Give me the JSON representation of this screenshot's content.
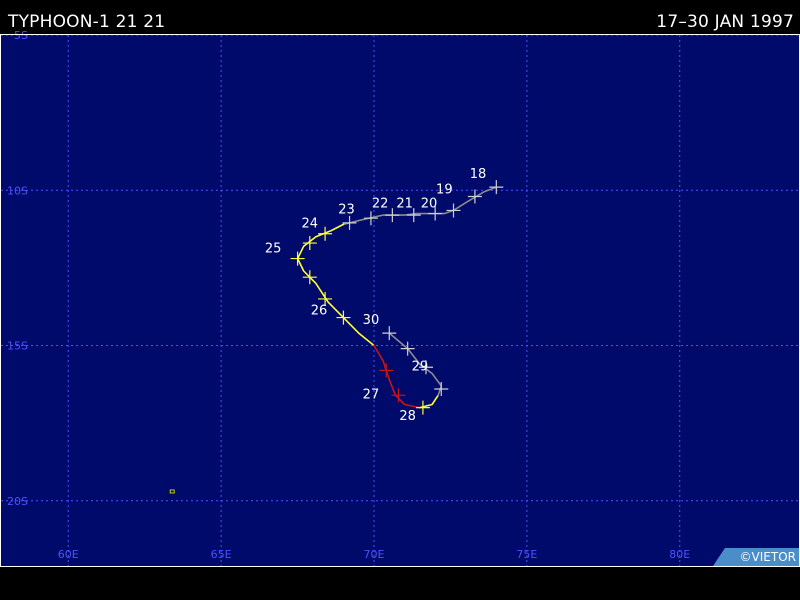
{
  "header": {
    "storm_title": "TYPHOON-1 21 21",
    "date_range": "17–30 JAN 1997"
  },
  "credit": "©VIETOR",
  "map": {
    "lon_range": [
      57.8,
      83.9
    ],
    "lat_range": [
      -5.0,
      -22.1
    ],
    "lon_ticks": [
      {
        "value": 60,
        "label": "60E"
      },
      {
        "value": 65,
        "label": "65E"
      },
      {
        "value": 70,
        "label": "70E"
      },
      {
        "value": 75,
        "label": "75E"
      },
      {
        "value": 80,
        "label": "80E"
      }
    ],
    "lat_ticks": [
      {
        "value": -5,
        "label": "5S"
      },
      {
        "value": -10,
        "label": "10S"
      },
      {
        "value": -15,
        "label": "15S"
      },
      {
        "value": -20,
        "label": "20S"
      }
    ],
    "colors": {
      "ocean": "#000a6b",
      "grid": "#4a52ff",
      "axis_label": "#4a52ff",
      "day_label": "#ffffff"
    },
    "intensity_colors": {
      "depression": "#8c8c8c",
      "storm": "#ffff33",
      "typhoon": "#c81414"
    },
    "islands": [
      {
        "lon": 63.4,
        "lat": -19.7,
        "color": "#c8c814"
      }
    ],
    "track_segments": [
      {
        "category": "depression",
        "points": [
          [
            74.0,
            -9.9
          ],
          [
            73.6,
            -10.05
          ],
          [
            73.0,
            -10.4
          ],
          [
            72.6,
            -10.65
          ],
          [
            72.3,
            -10.75
          ],
          [
            71.4,
            -10.75
          ],
          [
            71.0,
            -10.8
          ],
          [
            70.3,
            -10.8
          ],
          [
            69.6,
            -10.95
          ],
          [
            69.0,
            -11.1
          ]
        ]
      },
      {
        "category": "storm",
        "points": [
          [
            69.0,
            -11.1
          ],
          [
            68.6,
            -11.3
          ],
          [
            68.1,
            -11.5
          ],
          [
            67.7,
            -11.8
          ],
          [
            67.5,
            -12.2
          ],
          [
            67.7,
            -12.6
          ],
          [
            68.1,
            -13.0
          ],
          [
            68.5,
            -13.6
          ],
          [
            69.0,
            -14.1
          ],
          [
            69.5,
            -14.6
          ],
          [
            70.0,
            -15.0
          ]
        ]
      },
      {
        "category": "typhoon",
        "points": [
          [
            70.0,
            -15.0
          ],
          [
            70.3,
            -15.5
          ],
          [
            70.5,
            -16.1
          ],
          [
            70.7,
            -16.6
          ],
          [
            71.0,
            -16.9
          ],
          [
            71.5,
            -17.0
          ]
        ]
      },
      {
        "category": "storm",
        "points": [
          [
            71.5,
            -17.0
          ],
          [
            71.9,
            -16.9
          ],
          [
            72.1,
            -16.6
          ]
        ]
      },
      {
        "category": "depression",
        "points": [
          [
            72.1,
            -16.6
          ],
          [
            72.2,
            -16.3
          ],
          [
            71.9,
            -15.9
          ],
          [
            71.5,
            -15.6
          ],
          [
            71.1,
            -15.1
          ],
          [
            70.5,
            -14.6
          ]
        ]
      }
    ],
    "fix_marks": [
      {
        "lon": 74.0,
        "lat": -9.9,
        "category": "depression"
      },
      {
        "lon": 73.3,
        "lat": -10.2,
        "category": "depression"
      },
      {
        "lon": 72.6,
        "lat": -10.65,
        "category": "depression"
      },
      {
        "lon": 72.0,
        "lat": -10.75,
        "category": "depression"
      },
      {
        "lon": 71.3,
        "lat": -10.8,
        "category": "depression"
      },
      {
        "lon": 70.6,
        "lat": -10.8,
        "category": "depression"
      },
      {
        "lon": 69.9,
        "lat": -10.9,
        "category": "depression"
      },
      {
        "lon": 69.2,
        "lat": -11.05,
        "category": "depression"
      },
      {
        "lon": 68.4,
        "lat": -11.4,
        "category": "storm"
      },
      {
        "lon": 67.9,
        "lat": -11.7,
        "category": "storm"
      },
      {
        "lon": 67.5,
        "lat": -12.2,
        "category": "storm"
      },
      {
        "lon": 67.9,
        "lat": -12.8,
        "category": "storm"
      },
      {
        "lon": 68.4,
        "lat": -13.5,
        "category": "storm"
      },
      {
        "lon": 69.0,
        "lat": -14.1,
        "category": "storm"
      },
      {
        "lon": 70.4,
        "lat": -15.8,
        "category": "typhoon"
      },
      {
        "lon": 70.8,
        "lat": -16.6,
        "category": "typhoon"
      },
      {
        "lon": 71.6,
        "lat": -17.0,
        "category": "storm"
      },
      {
        "lon": 72.2,
        "lat": -16.4,
        "category": "depression"
      },
      {
        "lon": 71.7,
        "lat": -15.7,
        "category": "depression"
      },
      {
        "lon": 71.1,
        "lat": -15.1,
        "category": "depression"
      },
      {
        "lon": 70.5,
        "lat": -14.6,
        "category": "depression"
      }
    ],
    "day_labels": [
      {
        "text": "18",
        "lon": 73.4,
        "lat": -9.6
      },
      {
        "text": "19",
        "lon": 72.3,
        "lat": -10.1
      },
      {
        "text": "20",
        "lon": 71.8,
        "lat": -10.55
      },
      {
        "text": "21",
        "lon": 71.0,
        "lat": -10.55
      },
      {
        "text": "22",
        "lon": 70.2,
        "lat": -10.55
      },
      {
        "text": "23",
        "lon": 69.1,
        "lat": -10.75
      },
      {
        "text": "24",
        "lon": 67.9,
        "lat": -11.2
      },
      {
        "text": "25",
        "lon": 66.7,
        "lat": -12.0
      },
      {
        "text": "26",
        "lon": 68.2,
        "lat": -14.0
      },
      {
        "text": "27",
        "lon": 69.9,
        "lat": -16.7
      },
      {
        "text": "28",
        "lon": 71.1,
        "lat": -17.4
      },
      {
        "text": "29",
        "lon": 71.5,
        "lat": -15.8
      },
      {
        "text": "30",
        "lon": 69.9,
        "lat": -14.3
      }
    ]
  }
}
